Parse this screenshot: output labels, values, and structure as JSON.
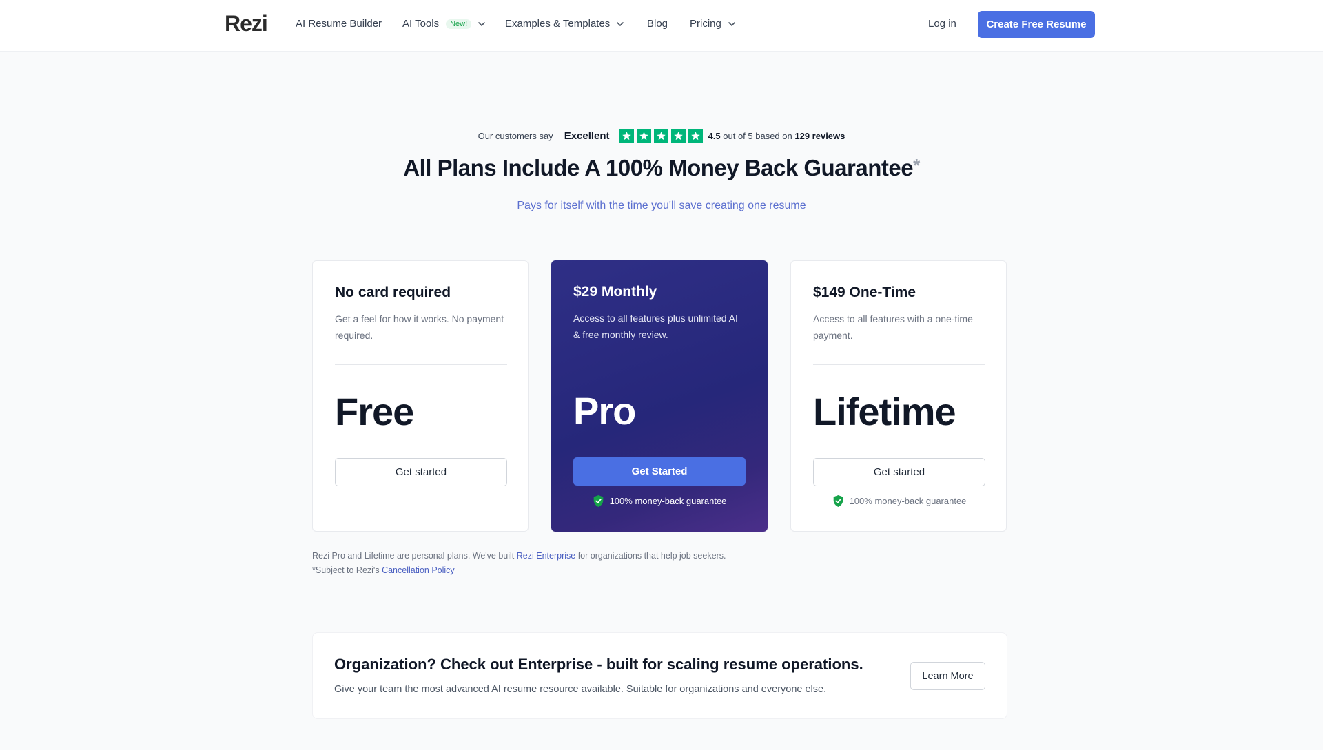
{
  "nav": {
    "logo": "Rezi",
    "items": [
      {
        "label": "AI Resume Builder"
      },
      {
        "label": "AI Tools",
        "badge": "New!"
      },
      {
        "label": "Examples & Templates"
      },
      {
        "label": "Blog"
      },
      {
        "label": "Pricing"
      }
    ],
    "login": "Log in",
    "cta": "Create Free Resume"
  },
  "review": {
    "prefix": "Our customers say",
    "rating_word": "Excellent",
    "score": "4.5",
    "out_of": "out of 5 based on",
    "count": "129 reviews",
    "star_color": "#00b67a"
  },
  "headline": "All Plans Include A 100% Money Back Guarantee",
  "headline_asterisk": "*",
  "subheadline": "Pays for itself with the time you'll save creating one resume",
  "plans": [
    {
      "title": "No card required",
      "description": "Get a feel for how it works. No payment required.",
      "name": "Free",
      "button": "Get started"
    },
    {
      "title": "$29 Monthly",
      "description": "Access to all features plus unlimited AI & free monthly review.",
      "name": "Pro",
      "button": "Get Started",
      "guarantee": "100% money-back guarantee"
    },
    {
      "title": "$149 One-Time",
      "description": "Access to all features with a one-time payment.",
      "name": "Lifetime",
      "button": "Get started",
      "guarantee": "100% money-back guarantee"
    }
  ],
  "notes": {
    "line1_pre": "Rezi Pro and Lifetime are personal plans. We've built",
    "line1_link": "Rezi Enterprise",
    "line1_post": "for organizations that help job seekers.",
    "line2_pre": "*Subject to Rezi's",
    "line2_link": "Cancellation Policy"
  },
  "enterprise": {
    "title": "Organization? Check out Enterprise - built for scaling resume operations.",
    "description": "Give your team the most advanced AI resume resource available. Suitable for organizations and everyone else.",
    "button": "Learn More"
  },
  "colors": {
    "accent": "#4a6fe3",
    "pro_card": "#2a2a80",
    "shield": "#16a34a"
  }
}
